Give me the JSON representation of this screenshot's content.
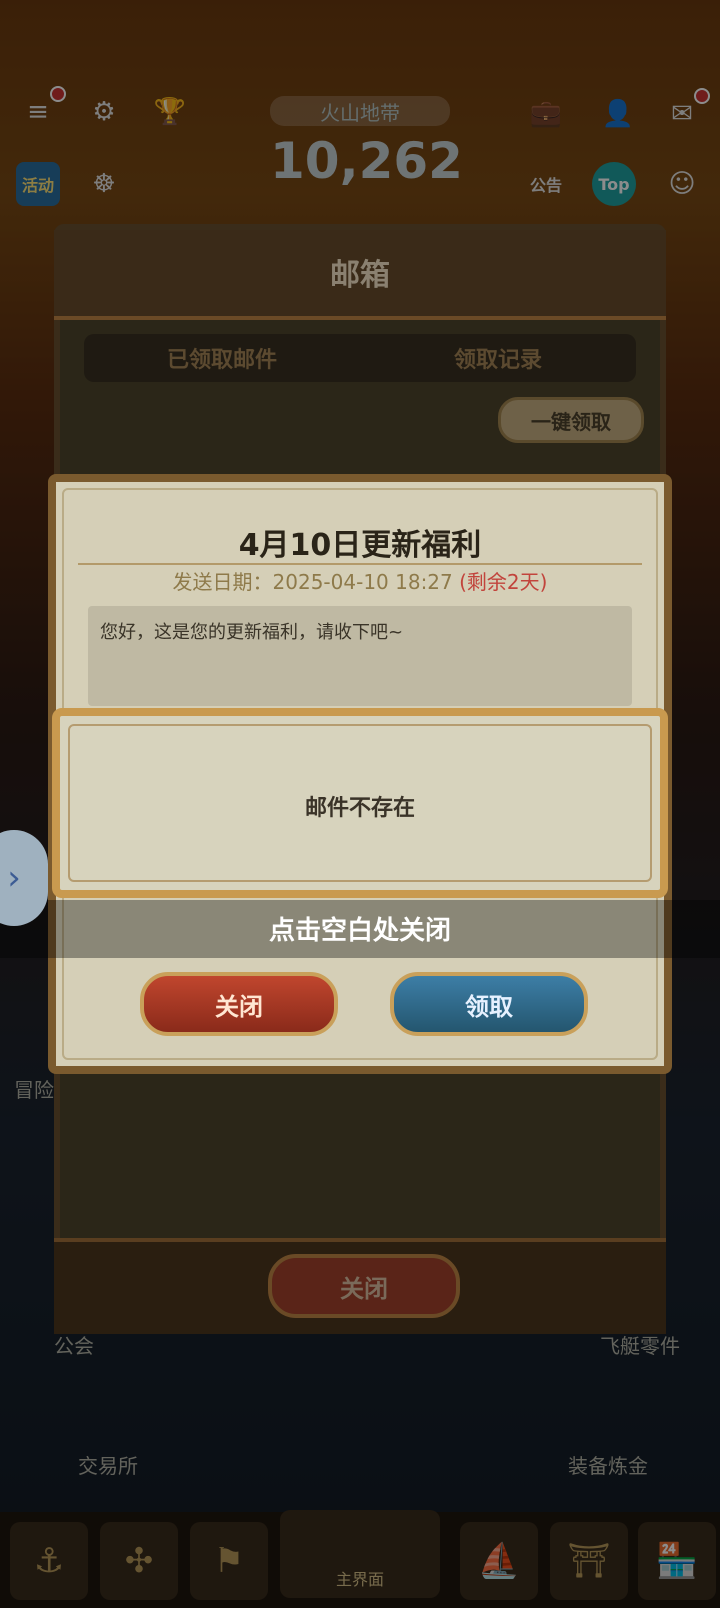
{
  "hud": {
    "location": "火山地带",
    "score": "10,262",
    "icons": [
      "menu-icon",
      "settings-icon",
      "trophy-icon",
      "briefcase-icon",
      "friend-icon",
      "mail-icon"
    ],
    "left_buttons": {
      "activity": "活动"
    },
    "right_buttons": {
      "notice": "公告",
      "top": "Top"
    }
  },
  "mailbox": {
    "title": "邮箱",
    "tabs": [
      "已领取邮件",
      "领取记录"
    ],
    "claim_all": "一键领取",
    "close": "关闭"
  },
  "mail_detail": {
    "title": "4月10日更新福利",
    "date_label": "发送日期：",
    "date_value": "2025-04-10 18:27",
    "remaining": "(剩余2天)",
    "body": "您好，这是您的更新福利，请收下吧~",
    "close_button": "关闭",
    "claim_button": "领取",
    "close_hint": "点击空白处关闭"
  },
  "toast": {
    "message": "邮件不存在"
  },
  "side_labels": {
    "guild": "公会",
    "airship_parts": "飞艇零件",
    "exchange": "交易所",
    "equip_refine": "装备炼金",
    "adventure": "冒险日"
  },
  "bottom_nav": {
    "main": "主界面"
  }
}
